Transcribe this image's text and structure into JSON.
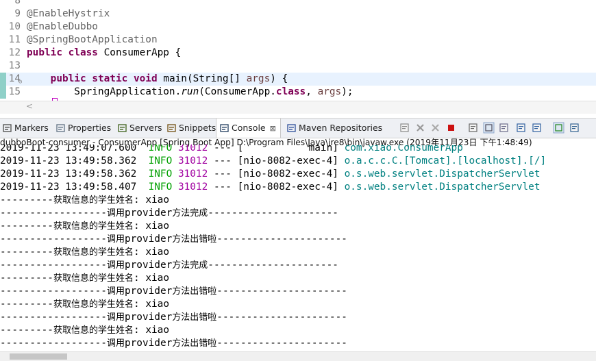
{
  "editor": {
    "lines": [
      {
        "num": "8",
        "parts": []
      },
      {
        "num": "9",
        "parts": [
          {
            "t": "@EnableHystrix",
            "c": "ann"
          }
        ]
      },
      {
        "num": "10",
        "parts": [
          {
            "t": "@EnableDubbo",
            "c": "ann"
          }
        ]
      },
      {
        "num": "11",
        "parts": [
          {
            "t": "@SpringBootApplication",
            "c": "ann"
          }
        ]
      },
      {
        "num": "12",
        "parts": [
          {
            "t": "public",
            "c": "kw"
          },
          {
            "t": " "
          },
          {
            "t": "class",
            "c": "kw"
          },
          {
            "t": " ConsumerApp {"
          }
        ]
      },
      {
        "num": "13",
        "parts": []
      },
      {
        "num": "14",
        "parts": [
          {
            "t": "    "
          },
          {
            "t": "public",
            "c": "kw"
          },
          {
            "t": " "
          },
          {
            "t": "static",
            "c": "kw"
          },
          {
            "t": " "
          },
          {
            "t": "void",
            "c": "kw"
          },
          {
            "t": " main(String[] "
          },
          {
            "t": "args",
            "c": "vr"
          },
          {
            "t": ") {"
          }
        ]
      },
      {
        "num": "15",
        "parts": [
          {
            "t": "        SpringApplication."
          },
          {
            "t": "run",
            "c": "it"
          },
          {
            "t": "(ConsumerApp."
          },
          {
            "t": "class",
            "c": "kw"
          },
          {
            "t": ", "
          },
          {
            "t": "args",
            "c": "vr"
          },
          {
            "t": ");"
          }
        ]
      }
    ],
    "scroll_left_arrow": "<"
  },
  "tabs": [
    {
      "label": "Markers",
      "icon": "markers-icon"
    },
    {
      "label": "Properties",
      "icon": "properties-icon"
    },
    {
      "label": "Servers",
      "icon": "servers-icon"
    },
    {
      "label": "Snippets",
      "icon": "snippets-icon"
    },
    {
      "label": "Console",
      "icon": "console-icon",
      "active": true,
      "close": "⊠"
    },
    {
      "label": "Maven Repositories",
      "icon": "maven-repositories-icon"
    }
  ],
  "console": {
    "title": "dubboBoot-consumer - ConsumerApp [Spring Boot App] D:\\Program Files\\Java\\jre8\\bin\\javaw.exe (2019年11月23日 下午1:48:49)",
    "log_lines": [
      {
        "date": "2019-11-23 13:49:07.600",
        "level": "INFO",
        "pid": "31012",
        "sep": "---",
        "thread": "[           main]",
        "cls": "com.xiao.ConsumerApp"
      },
      {
        "date": "2019-11-23 13:49:58.362",
        "level": "INFO",
        "pid": "31012",
        "sep": "---",
        "thread": "[nio-8082-exec-4]",
        "cls": "o.a.c.c.C.[Tomcat].[localhost].[/]"
      },
      {
        "date": "2019-11-23 13:49:58.362",
        "level": "INFO",
        "pid": "31012",
        "sep": "---",
        "thread": "[nio-8082-exec-4]",
        "cls": "o.s.web.servlet.DispatcherServlet"
      },
      {
        "date": "2019-11-23 13:49:58.407",
        "level": "INFO",
        "pid": "31012",
        "sep": "---",
        "thread": "[nio-8082-exec-4]",
        "cls": "o.s.web.servlet.DispatcherServlet"
      }
    ],
    "output": [
      {
        "pre": "---------",
        "cn": "获取信息的学生姓名",
        "tail": ": xiao",
        "post": ""
      },
      {
        "pre": "------------------",
        "cn": "调用",
        "tail": "provider",
        "cn2": "方法完成",
        "post": "----------------------"
      },
      {
        "pre": "---------",
        "cn": "获取信息的学生姓名",
        "tail": ": xiao",
        "post": ""
      },
      {
        "pre": "------------------",
        "cn": "调用",
        "tail": "provider",
        "cn2": "方法出错啦",
        "post": "----------------------"
      },
      {
        "pre": "---------",
        "cn": "获取信息的学生姓名",
        "tail": ": xiao",
        "post": ""
      },
      {
        "pre": "------------------",
        "cn": "调用",
        "tail": "provider",
        "cn2": "方法完成",
        "post": "----------------------"
      },
      {
        "pre": "---------",
        "cn": "获取信息的学生姓名",
        "tail": ": xiao",
        "post": ""
      },
      {
        "pre": "------------------",
        "cn": "调用",
        "tail": "provider",
        "cn2": "方法出错啦",
        "post": "----------------------"
      },
      {
        "pre": "---------",
        "cn": "获取信息的学生姓名",
        "tail": ": xiao",
        "post": ""
      },
      {
        "pre": "------------------",
        "cn": "调用",
        "tail": "provider",
        "cn2": "方法出错啦",
        "post": "----------------------"
      },
      {
        "pre": "---------",
        "cn": "获取信息的学生姓名",
        "tail": ": xiao",
        "post": ""
      },
      {
        "pre": "------------------",
        "cn": "调用",
        "tail": "provider",
        "cn2": "方法出错啦",
        "post": "----------------------"
      }
    ]
  },
  "toolbar_buttons": [
    "terminate-all-icon",
    "remove-launch-icon",
    "remove-all-terminated-icon",
    "terminate-icon",
    "clear-console-icon",
    "scroll-lock-icon",
    "word-wrap-icon",
    "show-on-output-icon",
    "show-on-error-icon",
    "pin-console-icon",
    "display-console-icon"
  ]
}
